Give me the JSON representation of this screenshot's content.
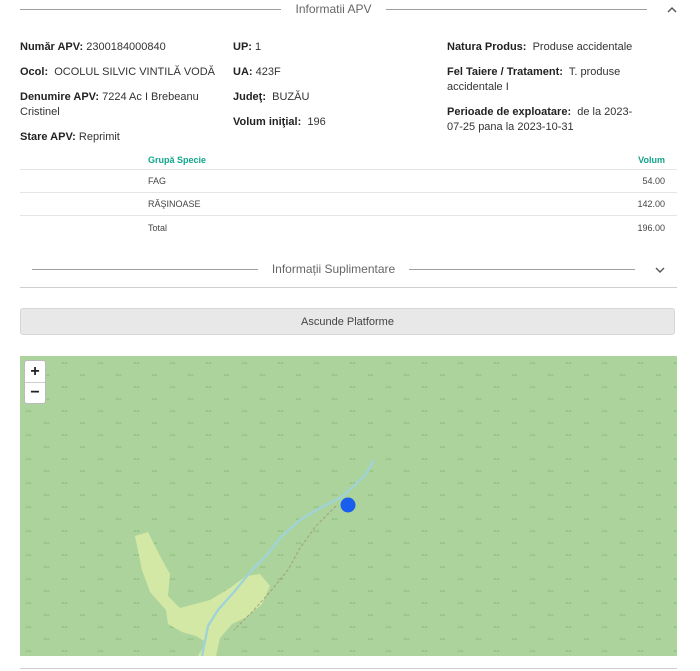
{
  "section1": {
    "title": "Informatii APV"
  },
  "section2": {
    "title": "Informații Suplimentare"
  },
  "info": {
    "numar_apv_label": "Număr APV:",
    "numar_apv_value": "2300184000840",
    "ocol_label": "Ocol:",
    "ocol_value": "OCOLUL SILVIC VINTILĂ VODĂ",
    "denumire_label": "Denumire APV:",
    "denumire_value": "7224 Ac I Brebeanu Cristinel",
    "stare_label": "Stare APV:",
    "stare_value": "Reprimit",
    "up_label": "UP:",
    "up_value": "1",
    "ua_label": "UA:",
    "ua_value": "423F",
    "judet_label": "Judeţ:",
    "judet_value": "BUZĂU",
    "volum_label": "Volum iniţial:",
    "volum_value": "196",
    "natura_label": "Natura Produs:",
    "natura_value": "Produse accidentale",
    "fel_label": "Fel Taiere / Tratament:",
    "fel_value": "T. produse accidentale I",
    "perioade_label": "Perioade de exploatare:",
    "perioade_value": "de la 2023-07-25 pana la 2023-10-31"
  },
  "table": {
    "header": [
      "Grupă Specie",
      "Volum"
    ],
    "rows": [
      [
        "FAG",
        "54.00"
      ],
      [
        "RĂŞINOASE",
        "142.00"
      ],
      [
        "Total",
        "196.00"
      ]
    ]
  },
  "buttons": {
    "platforme": "Ascunde Platforme"
  },
  "map": {
    "zoom_in": "+",
    "zoom_out": "−",
    "marker_color": "#1a5ef0",
    "forest_color": "#acd39c"
  }
}
